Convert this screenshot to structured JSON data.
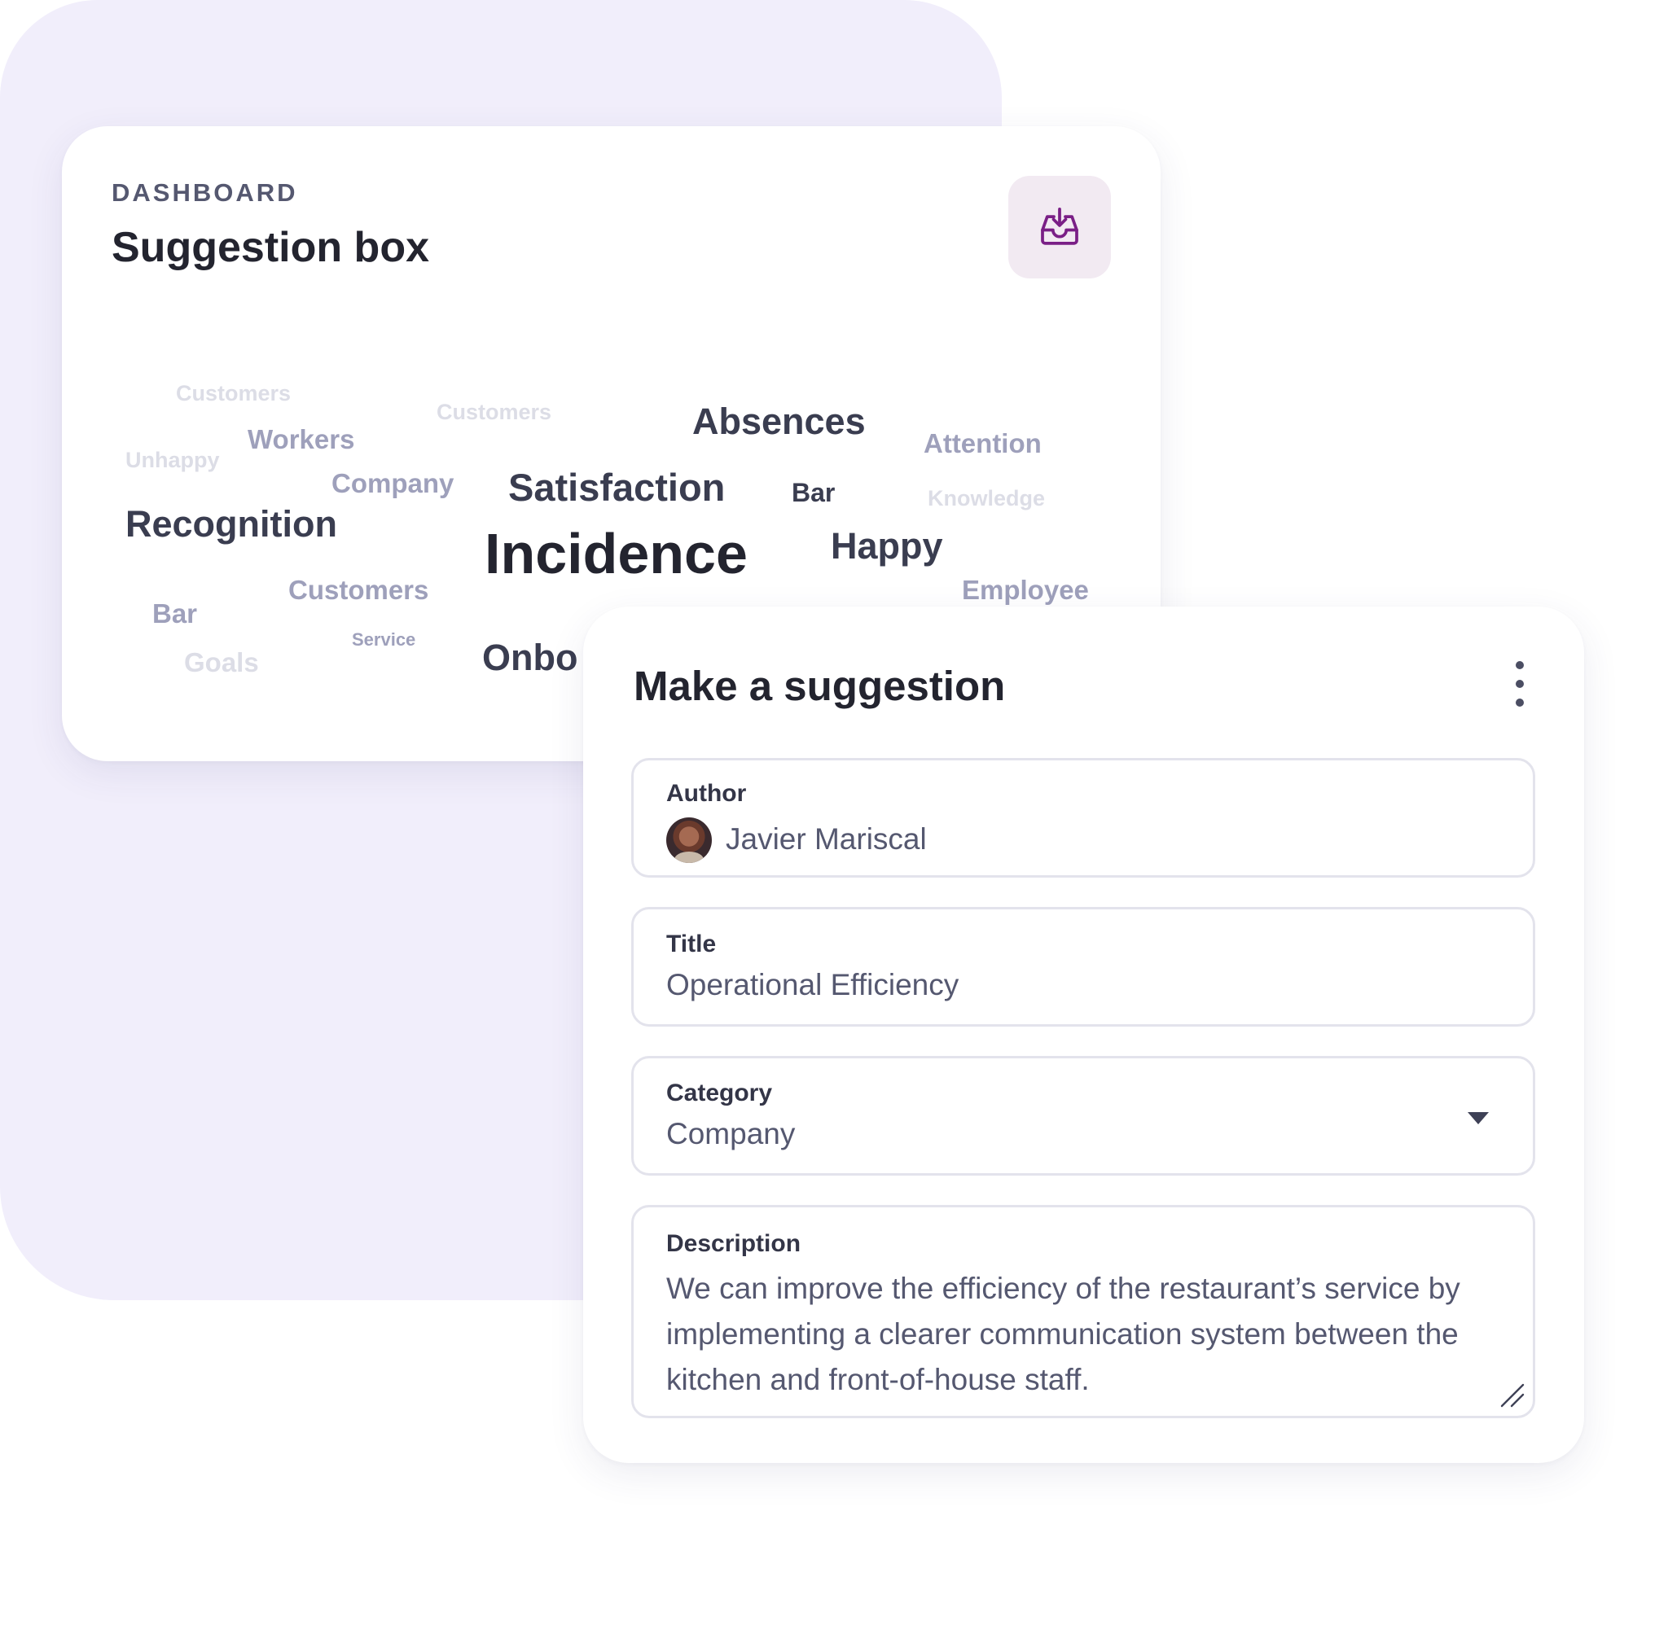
{
  "dashboard": {
    "eyebrow": "DASHBOARD",
    "title": "Suggestion box",
    "export_icon": "inbox-download-icon",
    "word_cloud": [
      {
        "text": "Customers",
        "weight": "faint"
      },
      {
        "text": "Customers",
        "weight": "faint"
      },
      {
        "text": "Absences",
        "weight": "strong"
      },
      {
        "text": "Workers",
        "weight": "medium"
      },
      {
        "text": "Attention",
        "weight": "medium"
      },
      {
        "text": "Unhappy",
        "weight": "faint"
      },
      {
        "text": "Company",
        "weight": "medium"
      },
      {
        "text": "Satisfaction",
        "weight": "strong"
      },
      {
        "text": "Bar",
        "weight": "strong"
      },
      {
        "text": "Knowledge",
        "weight": "faint"
      },
      {
        "text": "Recognition",
        "weight": "strong"
      },
      {
        "text": "Incidence",
        "weight": "strongest"
      },
      {
        "text": "Happy",
        "weight": "strong"
      },
      {
        "text": "Customers",
        "weight": "medium"
      },
      {
        "text": "Employee",
        "weight": "medium"
      },
      {
        "text": "Bar",
        "weight": "medium"
      },
      {
        "text": "Goals",
        "weight": "faint"
      },
      {
        "text": "Service",
        "weight": "medium"
      },
      {
        "text": "Onbo",
        "weight": "strong"
      }
    ]
  },
  "suggestion": {
    "title": "Make a suggestion",
    "menu_icon": "more-vertical-icon",
    "author": {
      "label": "Author",
      "value": "Javier Mariscal"
    },
    "title_field": {
      "label": "Title",
      "value": "Operational Efficiency"
    },
    "category": {
      "label": "Category",
      "value": "Company"
    },
    "description": {
      "label": "Description",
      "value": "We can improve the efficiency of the restaurant’s service by implementing a clearer communication system between the kitchen and front-of-house staff."
    }
  },
  "colors": {
    "background_blob": "#f1eefb",
    "accent_purple": "#7a1f86",
    "export_button_bg": "#f2eaf2",
    "text_dark": "#23242f",
    "text_muted": "#555870"
  }
}
